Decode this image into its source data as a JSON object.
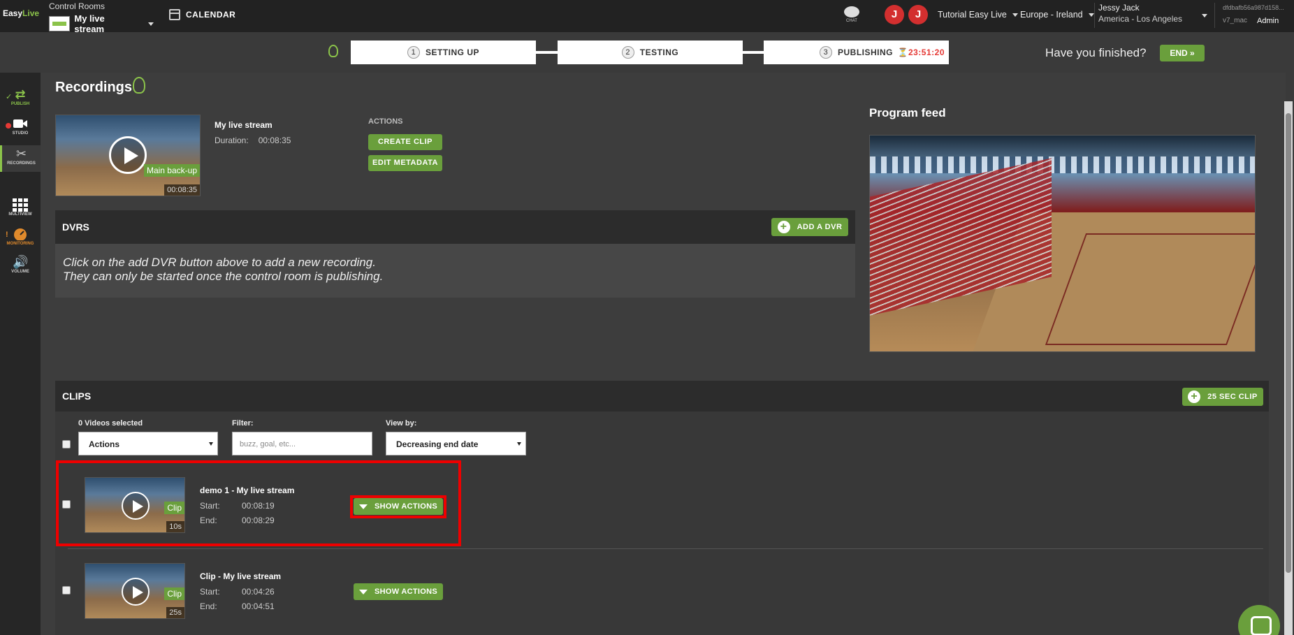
{
  "app": {
    "logo": "Easy",
    "logo_accent": "Live",
    "control_rooms_label": "Control Rooms",
    "stream_name": "My live stream",
    "calendar": "CALENDAR",
    "chat": "CHAT",
    "avatars": [
      "J",
      "J"
    ],
    "tutorial": "Tutorial Easy Live",
    "region": "Europe - Ireland",
    "user_name": "Jessy Jack",
    "user_tz": "America - Los Angeles",
    "hash": "dfdbafb56a987d158...",
    "mac": "v7_mac",
    "role": "Admin"
  },
  "steps": [
    {
      "num": "1",
      "label": "SETTING UP"
    },
    {
      "num": "2",
      "label": "TESTING"
    },
    {
      "num": "3",
      "label": "PUBLISHING"
    }
  ],
  "timer": "23:51:20",
  "finished_text": "Have you finished?",
  "end_label": "END  »",
  "sidebar": [
    {
      "label": "PUBLISH",
      "icon": "shuffle-icon"
    },
    {
      "label": "STUDIO",
      "icon": "camera-icon"
    },
    {
      "label": "RECORDINGS",
      "icon": "scissors-icon"
    },
    {
      "label": "MULTIVIEW",
      "icon": "grid-icon"
    },
    {
      "label": "MONITORING",
      "icon": "gauge-icon"
    },
    {
      "label": "VOLUME",
      "icon": "speaker-icon"
    }
  ],
  "page_title": "Recordings",
  "recording": {
    "name": "My live stream",
    "duration_label": "Duration:",
    "duration": "00:08:35",
    "tag": "Main back-up",
    "time": "00:08:35",
    "actions_label": "ACTIONS",
    "create_clip": "CREATE CLIP",
    "edit_metadata": "EDIT METADATA"
  },
  "dvrs": {
    "title": "DVRS",
    "add_label": "ADD A DVR",
    "msg1": "Click on the add DVR button above to add a new recording.",
    "msg2": "They can only be started once the control room is publishing."
  },
  "program_feed": "Program feed",
  "clips": {
    "title": "CLIPS",
    "add_label": "25 SEC CLIP",
    "selected": "0  Videos selected",
    "actions_select": "Actions",
    "filter_label": "Filter:",
    "filter_placeholder": "buzz, goal, etc...",
    "viewby_label": "View by:",
    "viewby_value": "Decreasing end date",
    "items": [
      {
        "name": "demo 1 - My live stream",
        "start_label": "Start:",
        "start": "00:08:19",
        "end_label": "End:",
        "end": "00:08:29",
        "tag": "Clip",
        "dur": "10s",
        "btn": "SHOW ACTIONS"
      },
      {
        "name": "Clip - My live stream",
        "start_label": "Start:",
        "start": "00:04:26",
        "end_label": "End:",
        "end": "00:04:51",
        "tag": "Clip",
        "dur": "25s",
        "btn": "SHOW ACTIONS"
      }
    ]
  },
  "colors": {
    "accent": "#6a9f3c",
    "alert": "#e53935",
    "highlight": "#ee0000"
  }
}
